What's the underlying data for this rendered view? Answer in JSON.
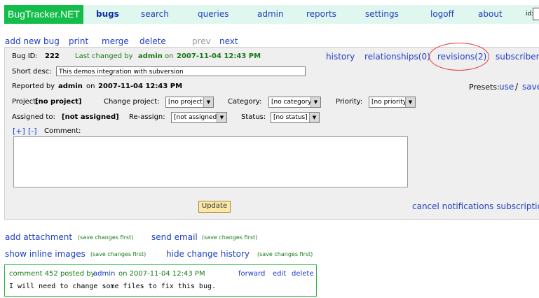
{
  "app": {
    "logo": "BugTracker.NET"
  },
  "nav": {
    "bugs": "bugs",
    "search": "search",
    "queries": "queries",
    "admin": "admin",
    "reports": "reports",
    "settings": "settings",
    "logoff": "logoff",
    "about": "about",
    "id_label": "id:"
  },
  "actions": {
    "add_new_bug": "add new bug",
    "print": "print",
    "merge": "merge",
    "delete": "delete",
    "prev": "prev",
    "next": "next"
  },
  "bug": {
    "id_label": "Bug ID:",
    "id": "222",
    "last_changed_prefix": "Last changed by",
    "last_changed_user": "admin",
    "last_changed_on": "on",
    "last_changed_date": "2007-11-04 12:43 PM",
    "short_desc_label": "Short desc:",
    "short_desc": "This demos integration with subversion",
    "reported_by_label": "Reported by",
    "reported_by": "admin",
    "reported_on": "on",
    "reported_date": "2007-11-04 12:43 PM",
    "project_label": "Project:",
    "project": "[no project]",
    "change_project_label": "Change project:",
    "change_project_value": "[no project]",
    "category_label": "Category:",
    "category_value": "[no category]",
    "priority_label": "Priority:",
    "priority_value": "[no priority]",
    "assigned_label": "Assigned to:",
    "assigned": "[not assigned]",
    "reassign_label": "Re-assign:",
    "reassign_value": "[not assigned]",
    "status_label": "Status:",
    "status_value": "[no status]",
    "expand": "[+]",
    "collapse": "[-]",
    "comment_label": "Comment:"
  },
  "links": {
    "history": "history",
    "relationships": "relationships(0)",
    "revisions": "revisions(2)",
    "subscribers": "subscribers",
    "presets_label": "Presets:",
    "presets_use": "use",
    "presets_sep": "/",
    "presets_save": "save",
    "cancel_notifications": "cancel notifications subscription"
  },
  "buttons": {
    "update": "Update"
  },
  "lower": {
    "add_attachment": "add attachment",
    "save_first_1": "(save changes first)",
    "send_email": "send email",
    "save_first_2": "(save changes first)",
    "show_inline_images": "show inline images",
    "save_first_3": "(save changes first)",
    "hide_change_history": "hide change history",
    "save_first_4": "(save changes first)"
  },
  "comment": {
    "header_prefix": "comment 452 posted by",
    "user": "admin",
    "date": "on 2007-11-04 12:43 PM",
    "forward": "forward",
    "edit": "edit",
    "delete": "delete",
    "text": "I will need to change some files to fix this bug."
  },
  "colors": {
    "logo_bg": "#13bd4a",
    "nav_bg": "#dff7ee",
    "link": "#1f3fc7",
    "highlight_circle": "#e53b3b"
  }
}
